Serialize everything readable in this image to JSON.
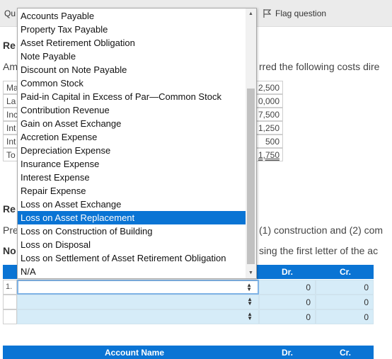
{
  "question_bar": {
    "label": "Qu",
    "flag_label": "Flag question"
  },
  "heading1_fragment": "Re",
  "intro_fragment_left": "Am",
  "intro_fragment_right": "rred the following costs dire",
  "cost_rows": [
    {
      "label": "Ma",
      "value": "2,500"
    },
    {
      "label": "La",
      "value": "0,000"
    },
    {
      "label": "Inc",
      "value": "7,500"
    },
    {
      "label": "Int",
      "value": "1,250"
    },
    {
      "label": "Int",
      "value": "500"
    },
    {
      "label": "To",
      "value": "1,750"
    }
  ],
  "heading2_fragment": "Re",
  "req_fragment_left": "Pre",
  "req_fragment_right": "(1) construction and (2) com",
  "note_fragment_left": "No",
  "note_fragment_right": "sing the first letter of the ac",
  "journal": {
    "col_dr": "Dr.",
    "col_cr": "Cr.",
    "col_account": "Account Name",
    "rows": [
      {
        "num": "1.",
        "dr": "0",
        "cr": "0"
      },
      {
        "num": "",
        "dr": "0",
        "cr": "0"
      },
      {
        "num": "",
        "dr": "0",
        "cr": "0"
      }
    ]
  },
  "dropdown": {
    "selected_index": 15,
    "options": [
      "Accounts Payable",
      "Property Tax Payable",
      "Asset Retirement Obligation",
      "Note Payable",
      "Discount on Note Payable",
      "Common Stock",
      "Paid-in Capital in Excess of Par—Common Stock",
      "Contribution Revenue",
      "Gain on Asset Exchange",
      "Accretion Expense",
      "Depreciation Expense",
      "Insurance Expense",
      "Interest Expense",
      "Repair Expense",
      "Loss on Asset Exchange",
      "Loss on Asset Replacement",
      "Loss on Construction of Building",
      "Loss on Disposal",
      "Loss on Settlement of Asset Retirement Obligation",
      "N/A"
    ]
  },
  "colors": {
    "accent": "#0a74d4",
    "input_bg": "#d6ecf8",
    "bar_bg": "#ebebeb"
  }
}
